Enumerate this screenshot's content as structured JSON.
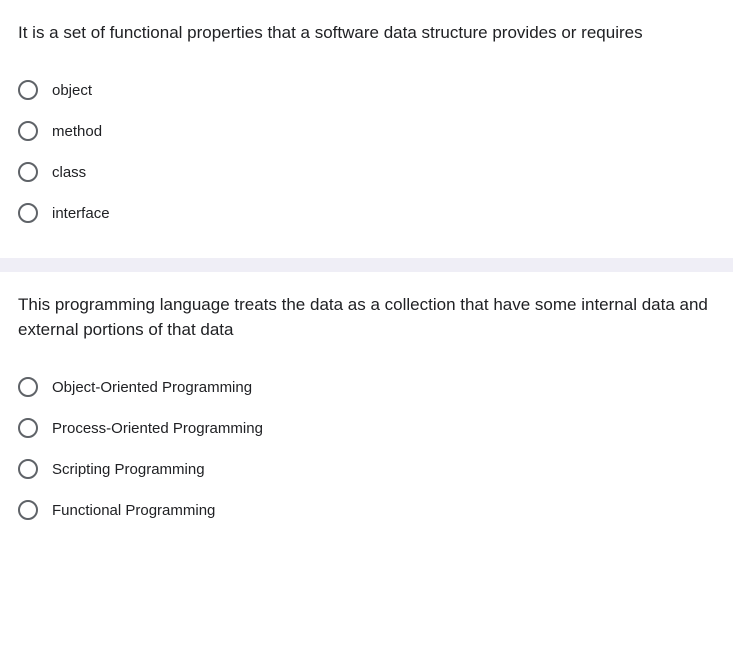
{
  "questions": [
    {
      "prompt": "It is a set of functional properties that a software data structure provides or requires",
      "options": [
        {
          "label": "object"
        },
        {
          "label": "method"
        },
        {
          "label": "class"
        },
        {
          "label": "interface"
        }
      ]
    },
    {
      "prompt": "This programming language treats the data as a collection that have some internal data and external portions of that data",
      "options": [
        {
          "label": "Object-Oriented Programming"
        },
        {
          "label": "Process-Oriented Programming"
        },
        {
          "label": "Scripting Programming"
        },
        {
          "label": "Functional Programming"
        }
      ]
    }
  ]
}
